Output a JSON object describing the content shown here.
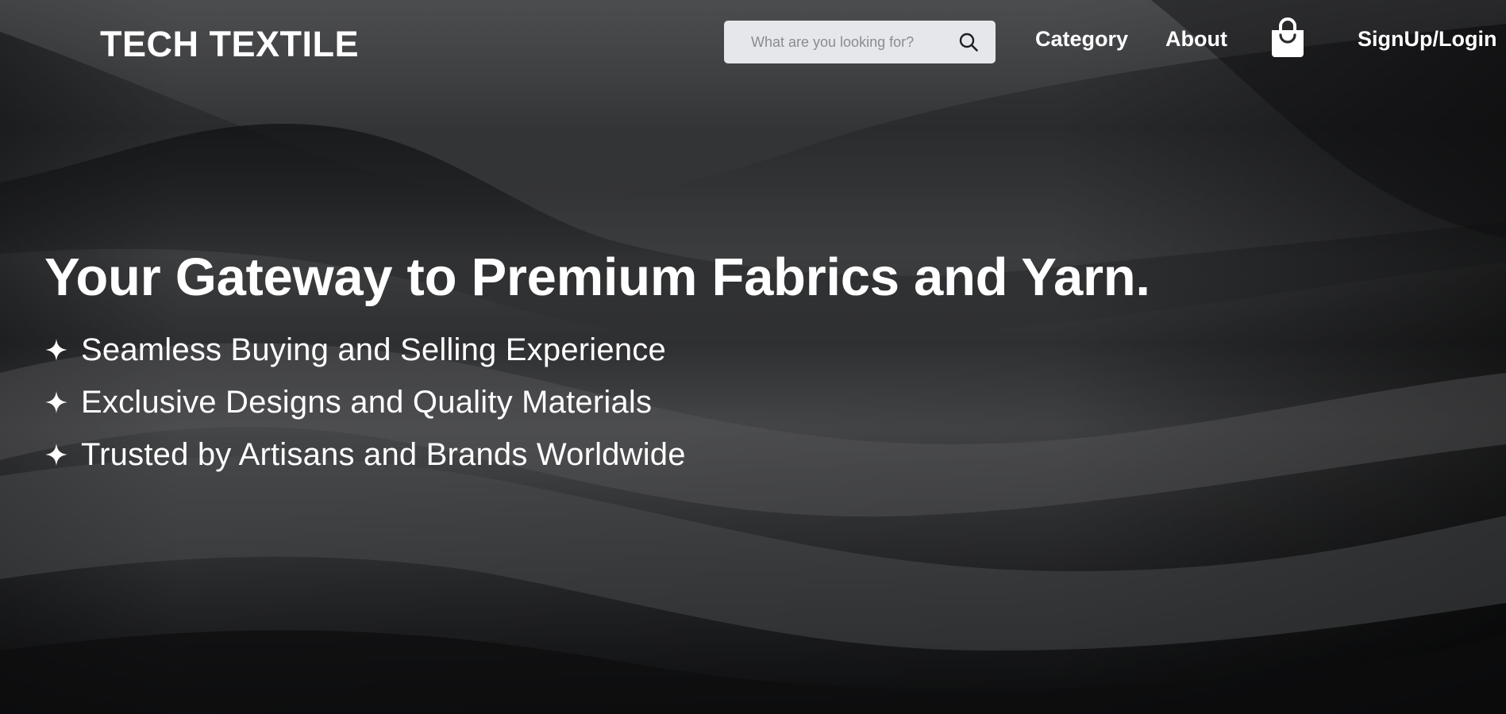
{
  "header": {
    "logo": "TECH TEXTILE",
    "search": {
      "placeholder": "What are you looking for?",
      "icon": "search-icon"
    },
    "nav": {
      "category": "Category",
      "about": "About",
      "cart_icon": "shopping-bag-icon",
      "login": "SignUp/Login"
    }
  },
  "hero": {
    "headline": "Your Gateway to Premium Fabrics and Yarn.",
    "bullet_icon": "sparkle-icon",
    "features": [
      "Seamless Buying and Selling Experience",
      "Exclusive Designs and Quality Materials",
      "Trusted by Artisans and Brands Worldwide"
    ]
  },
  "colors": {
    "text": "#ffffff",
    "search_bg": "#e6e7ea",
    "background": "#2a2b2d"
  }
}
